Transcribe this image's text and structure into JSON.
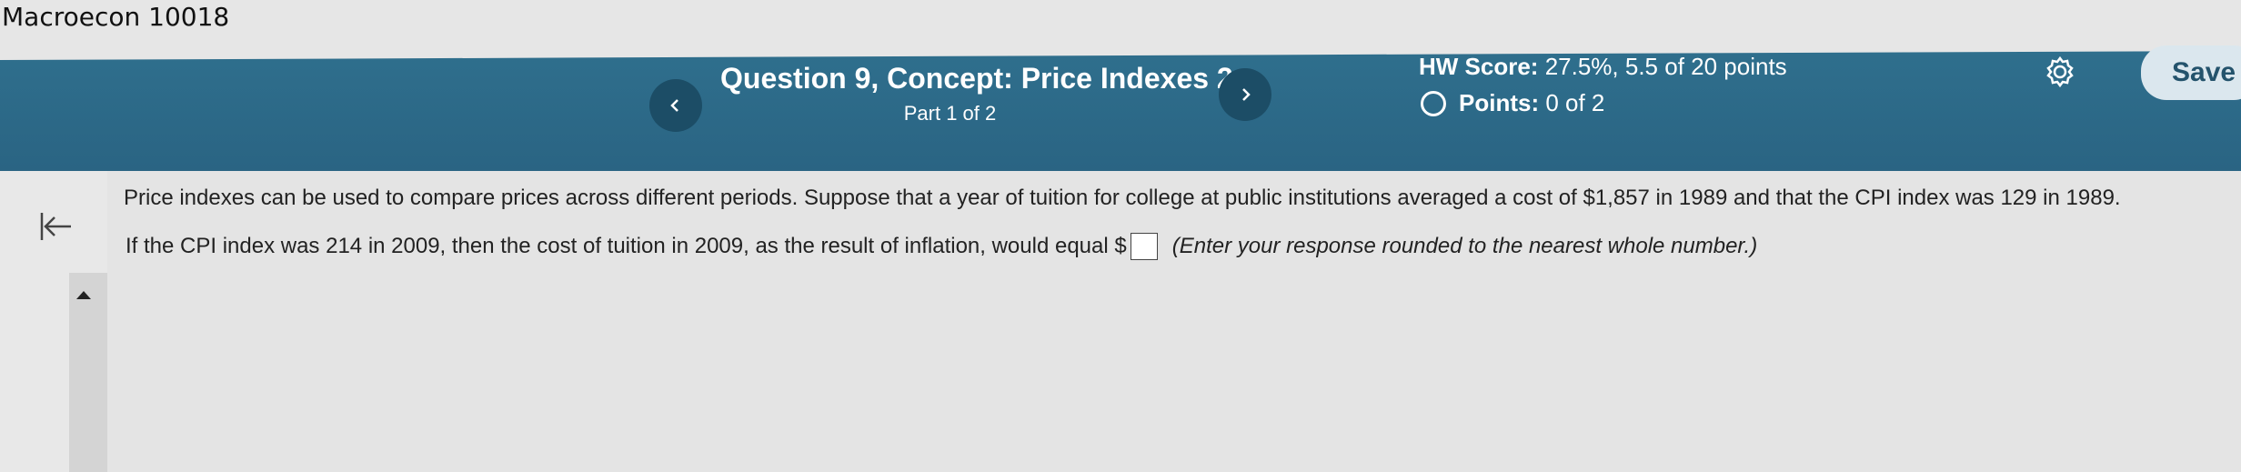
{
  "app": {
    "title": "Macroecon 10018"
  },
  "header": {
    "question_title": "Question 9, Concept: Price Indexes 2",
    "part": "Part 1 of 2",
    "hw_score_label": "HW Score:",
    "hw_score_value": "27.5%, 5.5 of 20 points",
    "points_label": "Points:",
    "points_value": "0 of 2",
    "save_label": "Save",
    "colors": {
      "bar": "#2f6f8d",
      "button": "#1c4d66",
      "save_bg": "#dbe7ee"
    }
  },
  "icons": {
    "prev": "chevron-left-icon",
    "next": "chevron-right-icon",
    "settings": "gear-icon",
    "back": "back-to-start-icon",
    "scroll_up": "up-arrow-icon"
  },
  "question": {
    "text1": "Price indexes can be used to compare prices across different periods. Suppose that a year of tuition for college at public institutions averaged a cost of $1,857 in 1989 and that the CPI index was 129 in 1989.",
    "text2_prefix": "If the CPI index was 214 in 2009, then the cost of tuition in 2009, as the result of inflation, would equal $",
    "hint": "(Enter your response rounded to the nearest whole number.)",
    "answer_value": ""
  }
}
